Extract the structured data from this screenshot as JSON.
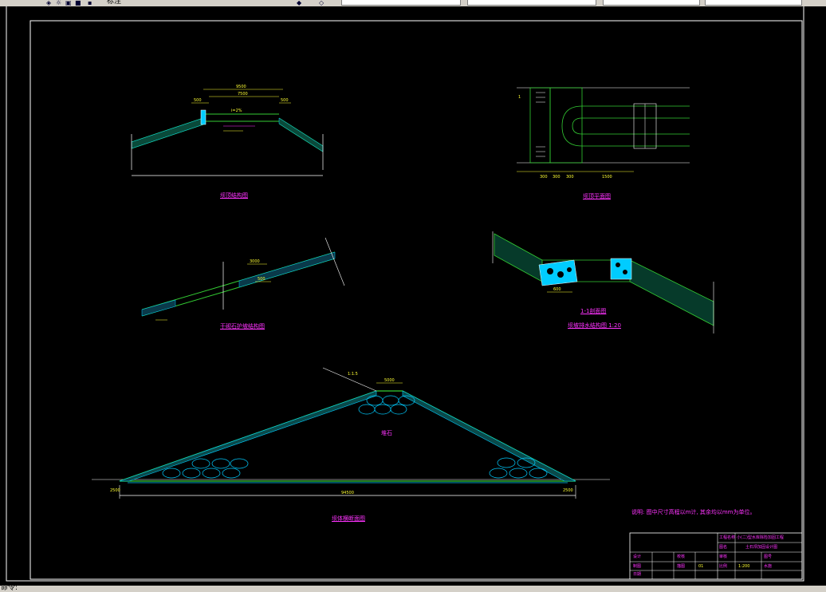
{
  "toolbar": {
    "label_fragment": "标注",
    "icons": [
      "layer-icon",
      "sun-icon",
      "lock-icon",
      "color-icon",
      "match-prop-icon",
      "layer-prev-icon"
    ]
  },
  "status": {
    "text": "命令:"
  },
  "colors": {
    "background": "#000000",
    "frame": "#ffffff",
    "section_green": "#33cc33",
    "fill_cyan": "#00ccff",
    "dimension_yellow": "#ffff33",
    "caption_magenta": "#ff33ff"
  },
  "drawing": {
    "captions": {
      "crown_section": "坝顶结构图",
      "plan": "坝顶平面图",
      "slope_protection": "干砌石护坡结构图",
      "drain_section": "1-1剖面图",
      "drain_detail": "坝坡排水结构图 1:20",
      "dam_section": "坝体横断面图"
    },
    "labels": {
      "rockfill": "堆石",
      "section_mark": "1",
      "scale_ratio": "1:1.5"
    },
    "dimensions": {
      "crown_top": "9500",
      "crown_width": "7500",
      "crown_edge_left": "500",
      "crown_edge_right": "500",
      "crown_slope": "i=2%",
      "plan_a": "300",
      "plan_b": "300",
      "plan_c": "300",
      "plan_d": "1500",
      "protection_a": "3000",
      "protection_b": "500",
      "drain_w": "600",
      "dam_top": "5000",
      "dam_base": "94500",
      "dam_toe_left": "2500",
      "dam_toe_right": "2500"
    },
    "note": "说明: 图中尺寸高程以m计, 其余均以mm为单位。"
  },
  "title_block": {
    "company_label": "工程名称",
    "project_name": "小(二)型水库除险加固工程",
    "drawing_label": "图名",
    "drawing_name": "土石坝加固设计图",
    "row1": [
      "设计",
      "",
      "校核",
      "",
      "审核",
      "图号"
    ],
    "row2": [
      "制图",
      "",
      "描图",
      "",
      "比例",
      "1:200"
    ],
    "sheet_code": "水施",
    "sheet_no": "01",
    "date_label": "日期"
  }
}
